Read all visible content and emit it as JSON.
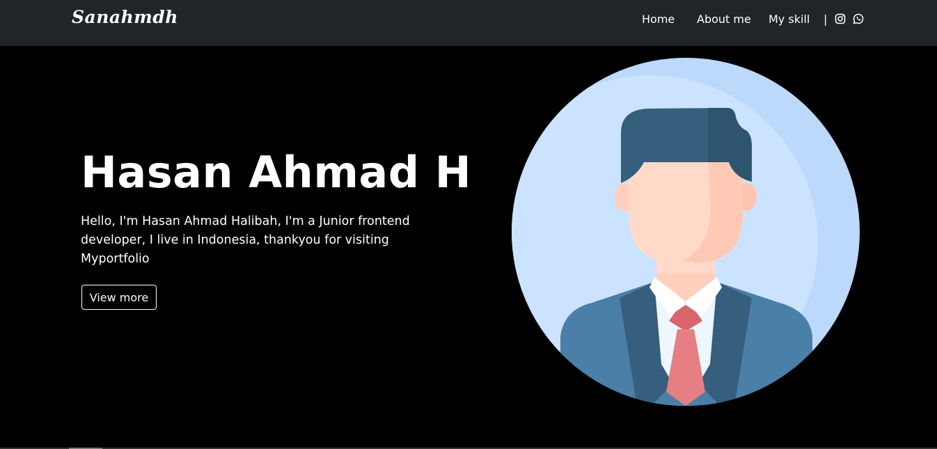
{
  "navbar": {
    "brand": "Sanahmdh",
    "links": [
      {
        "label": "Home"
      },
      {
        "label": "About me"
      },
      {
        "label": "My skill"
      }
    ],
    "separator": "|",
    "icons": [
      "instagram-icon",
      "whatsapp-icon"
    ]
  },
  "hero": {
    "title": "Hasan Ahmad H",
    "description": "Hello, I'm Hasan Ahmad Halibah, I'm a Junior frontend developer, I live in Indonesia, thankyou for visiting Myportfolio",
    "button_label": "View more",
    "avatar": "businessman-avatar"
  },
  "colors": {
    "navbar_bg": "#212529",
    "page_bg": "#000000",
    "avatar_bg": "#cce3ff",
    "suit": "#4a7fa8",
    "tie": "#e57f84",
    "hair": "#365e7d",
    "skin": "#ffdac8"
  }
}
